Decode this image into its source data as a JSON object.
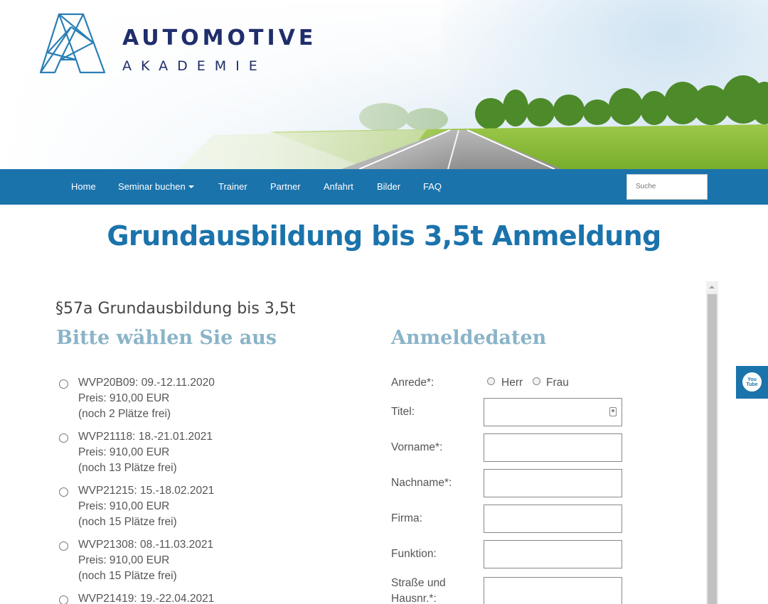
{
  "brand": {
    "title": "AUTOMOTIVE",
    "subtitle": "AKADEMIE"
  },
  "nav": {
    "items": [
      {
        "label": "Home"
      },
      {
        "label": "Seminar buchen"
      },
      {
        "label": "Trainer"
      },
      {
        "label": "Partner"
      },
      {
        "label": "Anfahrt"
      },
      {
        "label": "Bilder"
      },
      {
        "label": "FAQ"
      }
    ],
    "search_placeholder": "Suche"
  },
  "page": {
    "title": "Grundausbildung bis 3,5t Anmeldung",
    "course_heading": "§57a Grundausbildung bis 3,5t",
    "left_heading": "Bitte wählen Sie aus",
    "right_heading": "Anmeldedaten"
  },
  "seminars": [
    {
      "code": "WVP20B09: 09.-12.11.2020",
      "price": "Preis: 910,00 EUR",
      "seats": "(noch 2 Plätze frei)"
    },
    {
      "code": "WVP21118: 18.-21.01.2021",
      "price": "Preis: 910,00 EUR",
      "seats": "(noch 13 Plätze frei)"
    },
    {
      "code": "WVP21215: 15.-18.02.2021",
      "price": "Preis: 910,00 EUR",
      "seats": "(noch 15 Plätze frei)"
    },
    {
      "code": "WVP21308: 08.-11.03.2021",
      "price": "Preis: 910,00 EUR",
      "seats": "(noch 15 Plätze frei)"
    },
    {
      "code": "WVP21419: 19.-22.04.2021"
    }
  ],
  "form": {
    "anrede_label": "Anrede*:",
    "anrede_options": [
      "Herr",
      "Frau"
    ],
    "titel_label": "Titel:",
    "vorname_label": "Vorname*:",
    "nachname_label": "Nachname*:",
    "firma_label": "Firma:",
    "funktion_label": "Funktion:",
    "strasse_label_line1": "Straße und",
    "strasse_label_line2": "Hausnr.*:"
  },
  "social": {
    "youtube_label_line1": "You",
    "youtube_label_line2": "Tube"
  },
  "colors": {
    "primary": "#1b73ac",
    "brand_dark": "#1f2e6b",
    "heading_light": "#8ab4c8"
  }
}
